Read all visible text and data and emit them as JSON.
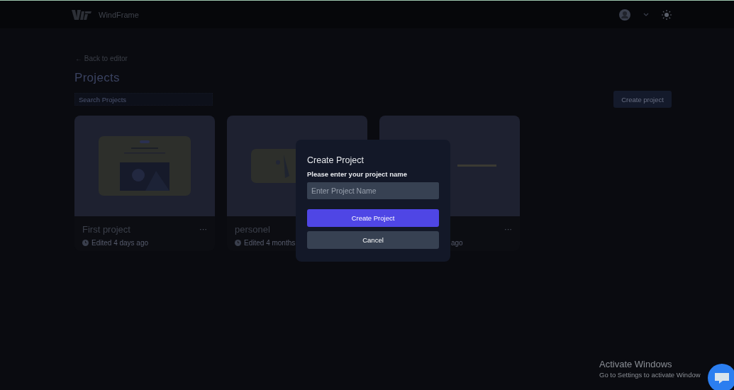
{
  "header": {
    "brand": "WindFrame"
  },
  "back_link": "← Back to editor",
  "page_title": "Projects",
  "search": {
    "placeholder": "Search Projects"
  },
  "create_button": "Create project",
  "projects": [
    {
      "title": "First project",
      "more": "···",
      "edited": "Edited 4 days ago"
    },
    {
      "title": "personel",
      "edited": "Edited 4 months"
    },
    {
      "more": "···",
      "edited": "ago"
    }
  ],
  "modal": {
    "title": "Create Project",
    "prompt": "Please enter your project name",
    "placeholder": "Enter Project Name",
    "confirm": "Create Project",
    "cancel": "Cancel"
  },
  "activation": {
    "title": "Activate Windows",
    "text": "Go to Settings to activate Window"
  }
}
